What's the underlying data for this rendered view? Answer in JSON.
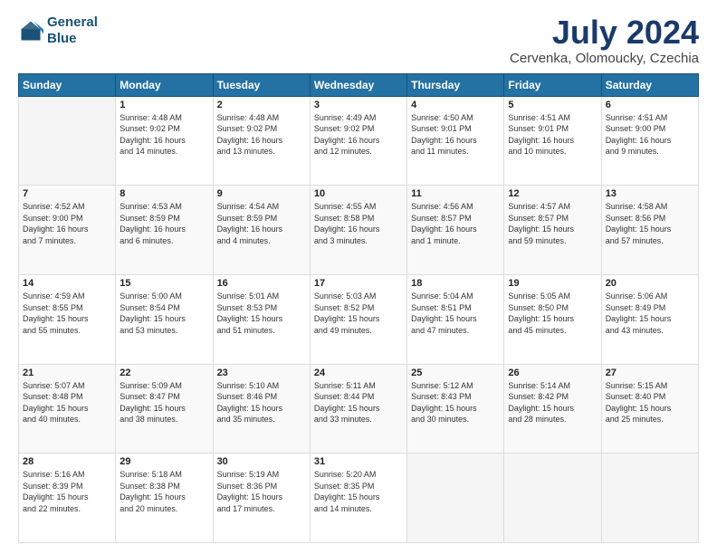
{
  "logo": {
    "line1": "General",
    "line2": "Blue"
  },
  "title": "July 2024",
  "subtitle": "Cervenka, Olomoucky, Czechia",
  "headers": [
    "Sunday",
    "Monday",
    "Tuesday",
    "Wednesday",
    "Thursday",
    "Friday",
    "Saturday"
  ],
  "weeks": [
    [
      {
        "day": "",
        "info": ""
      },
      {
        "day": "1",
        "info": "Sunrise: 4:48 AM\nSunset: 9:02 PM\nDaylight: 16 hours\nand 14 minutes."
      },
      {
        "day": "2",
        "info": "Sunrise: 4:48 AM\nSunset: 9:02 PM\nDaylight: 16 hours\nand 13 minutes."
      },
      {
        "day": "3",
        "info": "Sunrise: 4:49 AM\nSunset: 9:02 PM\nDaylight: 16 hours\nand 12 minutes."
      },
      {
        "day": "4",
        "info": "Sunrise: 4:50 AM\nSunset: 9:01 PM\nDaylight: 16 hours\nand 11 minutes."
      },
      {
        "day": "5",
        "info": "Sunrise: 4:51 AM\nSunset: 9:01 PM\nDaylight: 16 hours\nand 10 minutes."
      },
      {
        "day": "6",
        "info": "Sunrise: 4:51 AM\nSunset: 9:00 PM\nDaylight: 16 hours\nand 9 minutes."
      }
    ],
    [
      {
        "day": "7",
        "info": "Sunrise: 4:52 AM\nSunset: 9:00 PM\nDaylight: 16 hours\nand 7 minutes."
      },
      {
        "day": "8",
        "info": "Sunrise: 4:53 AM\nSunset: 8:59 PM\nDaylight: 16 hours\nand 6 minutes."
      },
      {
        "day": "9",
        "info": "Sunrise: 4:54 AM\nSunset: 8:59 PM\nDaylight: 16 hours\nand 4 minutes."
      },
      {
        "day": "10",
        "info": "Sunrise: 4:55 AM\nSunset: 8:58 PM\nDaylight: 16 hours\nand 3 minutes."
      },
      {
        "day": "11",
        "info": "Sunrise: 4:56 AM\nSunset: 8:57 PM\nDaylight: 16 hours\nand 1 minute."
      },
      {
        "day": "12",
        "info": "Sunrise: 4:57 AM\nSunset: 8:57 PM\nDaylight: 15 hours\nand 59 minutes."
      },
      {
        "day": "13",
        "info": "Sunrise: 4:58 AM\nSunset: 8:56 PM\nDaylight: 15 hours\nand 57 minutes."
      }
    ],
    [
      {
        "day": "14",
        "info": "Sunrise: 4:59 AM\nSunset: 8:55 PM\nDaylight: 15 hours\nand 55 minutes."
      },
      {
        "day": "15",
        "info": "Sunrise: 5:00 AM\nSunset: 8:54 PM\nDaylight: 15 hours\nand 53 minutes."
      },
      {
        "day": "16",
        "info": "Sunrise: 5:01 AM\nSunset: 8:53 PM\nDaylight: 15 hours\nand 51 minutes."
      },
      {
        "day": "17",
        "info": "Sunrise: 5:03 AM\nSunset: 8:52 PM\nDaylight: 15 hours\nand 49 minutes."
      },
      {
        "day": "18",
        "info": "Sunrise: 5:04 AM\nSunset: 8:51 PM\nDaylight: 15 hours\nand 47 minutes."
      },
      {
        "day": "19",
        "info": "Sunrise: 5:05 AM\nSunset: 8:50 PM\nDaylight: 15 hours\nand 45 minutes."
      },
      {
        "day": "20",
        "info": "Sunrise: 5:06 AM\nSunset: 8:49 PM\nDaylight: 15 hours\nand 43 minutes."
      }
    ],
    [
      {
        "day": "21",
        "info": "Sunrise: 5:07 AM\nSunset: 8:48 PM\nDaylight: 15 hours\nand 40 minutes."
      },
      {
        "day": "22",
        "info": "Sunrise: 5:09 AM\nSunset: 8:47 PM\nDaylight: 15 hours\nand 38 minutes."
      },
      {
        "day": "23",
        "info": "Sunrise: 5:10 AM\nSunset: 8:46 PM\nDaylight: 15 hours\nand 35 minutes."
      },
      {
        "day": "24",
        "info": "Sunrise: 5:11 AM\nSunset: 8:44 PM\nDaylight: 15 hours\nand 33 minutes."
      },
      {
        "day": "25",
        "info": "Sunrise: 5:12 AM\nSunset: 8:43 PM\nDaylight: 15 hours\nand 30 minutes."
      },
      {
        "day": "26",
        "info": "Sunrise: 5:14 AM\nSunset: 8:42 PM\nDaylight: 15 hours\nand 28 minutes."
      },
      {
        "day": "27",
        "info": "Sunrise: 5:15 AM\nSunset: 8:40 PM\nDaylight: 15 hours\nand 25 minutes."
      }
    ],
    [
      {
        "day": "28",
        "info": "Sunrise: 5:16 AM\nSunset: 8:39 PM\nDaylight: 15 hours\nand 22 minutes."
      },
      {
        "day": "29",
        "info": "Sunrise: 5:18 AM\nSunset: 8:38 PM\nDaylight: 15 hours\nand 20 minutes."
      },
      {
        "day": "30",
        "info": "Sunrise: 5:19 AM\nSunset: 8:36 PM\nDaylight: 15 hours\nand 17 minutes."
      },
      {
        "day": "31",
        "info": "Sunrise: 5:20 AM\nSunset: 8:35 PM\nDaylight: 15 hours\nand 14 minutes."
      },
      {
        "day": "",
        "info": ""
      },
      {
        "day": "",
        "info": ""
      },
      {
        "day": "",
        "info": ""
      }
    ]
  ]
}
